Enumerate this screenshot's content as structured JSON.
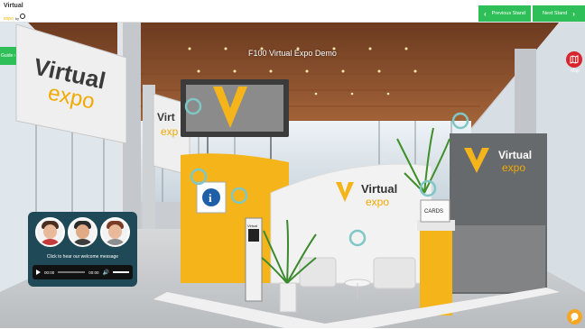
{
  "header": {
    "logo_line1": "Virtual",
    "logo_line2": "expo",
    "logo_by": "by ",
    "prev_label": "Previous Stand",
    "next_label": "Next Stand"
  },
  "scene": {
    "title": "F100 Virtual Expo Demo",
    "guide_label": "Guide",
    "map_label": "Map",
    "banner_word1": "Virtual",
    "banner_word2": "expo",
    "mid_banner": "Virt",
    "mid_banner2": "exp",
    "booth_word1": "Virtual",
    "booth_word2": "expo",
    "wall_word1": "Virtual",
    "wall_word2": "expo",
    "cards_label": "CARDS",
    "stand_label": "Virtual"
  },
  "welcome": {
    "caption": "Click to hear our welcome message",
    "time_start": "00:00",
    "time_end": "00:00"
  },
  "colors": {
    "accent_green": "#2fbf58",
    "brand_yellow": "#f4b41a",
    "map_red": "#d7262e",
    "panel_teal": "#1f4956"
  }
}
